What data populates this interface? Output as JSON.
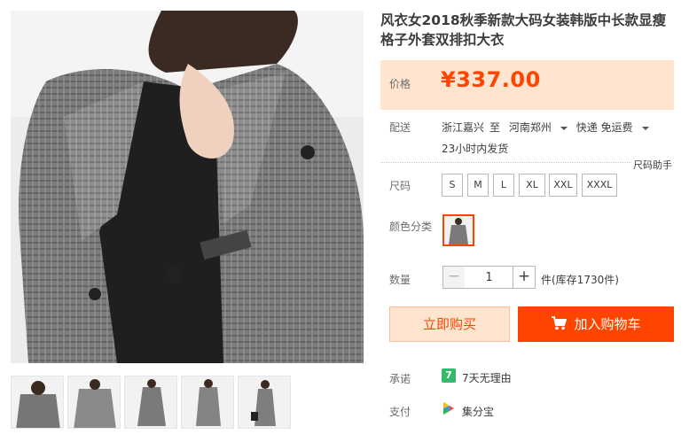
{
  "product": {
    "title": "风衣女2018秋季新款大码女装韩版中长款显瘦格子外套双排扣大衣"
  },
  "price": {
    "label": "价格",
    "value": "¥337.00"
  },
  "shipping": {
    "label": "配送",
    "from": "浙江嘉兴",
    "to_word": "至",
    "destination": "河南郑州",
    "method": "快递 免运费",
    "dispatch": "23小时内发货"
  },
  "size": {
    "label": "尺码",
    "helper": "尺码助手",
    "options": [
      "S",
      "M",
      "L",
      "XL",
      "XXL",
      "XXXL"
    ]
  },
  "color": {
    "label": "颜色分类"
  },
  "quantity": {
    "label": "数量",
    "minus": "−",
    "value": "1",
    "plus": "+",
    "stock": "件(库存1730件)"
  },
  "actions": {
    "buy_now": "立即购买",
    "add_to_cart": "加入购物车"
  },
  "promise": {
    "label": "承诺",
    "icon_text": "7",
    "text": "7天无理由"
  },
  "payment": {
    "label": "支付",
    "text": "集分宝"
  },
  "colors": {
    "accent": "#ff4400",
    "price_bg": "#ffe4d0",
    "promise_green": "#33b86c"
  },
  "icons": {
    "cart": "cart-icon",
    "promise": "seven-day-icon",
    "payment": "jifenbao-icon"
  }
}
